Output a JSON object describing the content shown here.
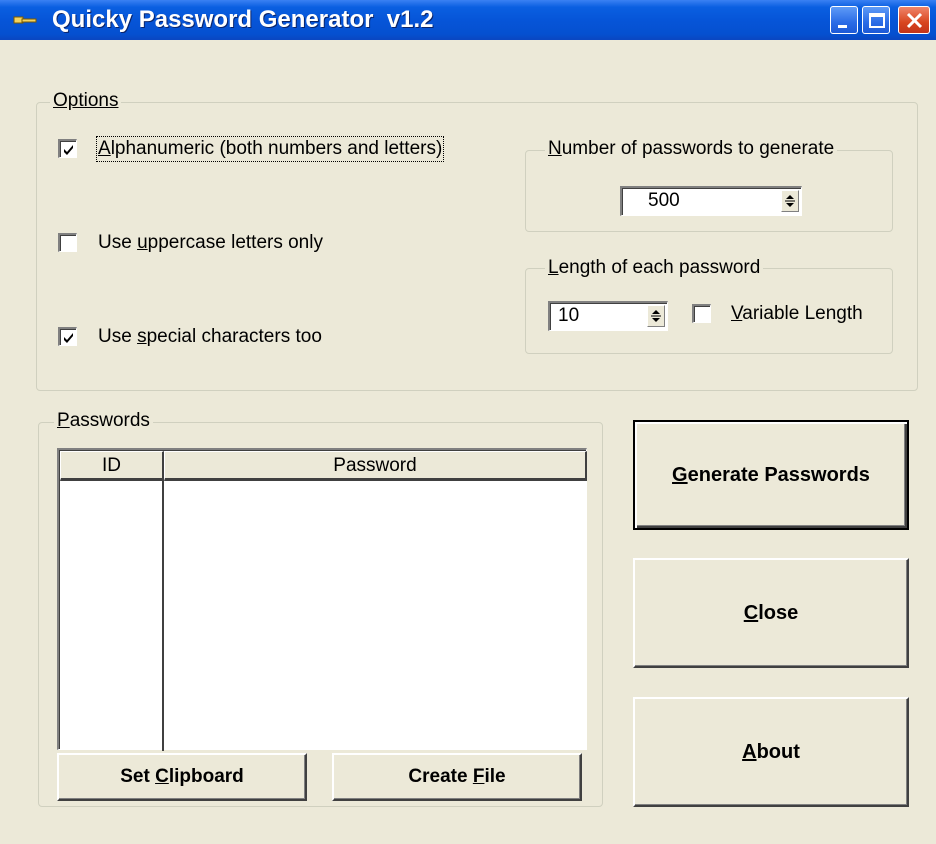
{
  "window": {
    "title": "Quicky Password Generator  v1.2"
  },
  "options": {
    "group_label": "Options",
    "alphanumeric": {
      "label": "Alphanumeric (both numbers and letters)",
      "mnemonic": "A",
      "checked": true
    },
    "uppercase_only": {
      "label_prefix": "Use ",
      "mnemonic": "u",
      "label_suffix": "ppercase letters only",
      "checked": false
    },
    "special_chars": {
      "label_prefix": "Use ",
      "mnemonic": "s",
      "label_suffix": "pecial characters too",
      "checked": true
    }
  },
  "count": {
    "group_label_mnemonic": "N",
    "group_label_rest": "umber of passwords to generate",
    "value": "500"
  },
  "length": {
    "group_label_prefix": "Length of each password",
    "value": "10",
    "variable_length": {
      "mnemonic": "V",
      "label_rest": "ariable Length",
      "checked": false
    }
  },
  "passwords": {
    "group_label_mnemonic": "P",
    "group_label_rest": "asswords",
    "columns": [
      "ID",
      "Password"
    ],
    "rows": []
  },
  "buttons": {
    "set_clipboard": {
      "prefix": "Set ",
      "mnemonic": "C",
      "rest": "lipboard"
    },
    "create_file": {
      "prefix": "Create ",
      "mnemonic": "F",
      "rest": "ile"
    },
    "generate": {
      "mnemonic": "G",
      "rest": "enerate Passwords"
    },
    "close": {
      "mnemonic": "C",
      "rest": "lose"
    },
    "about": {
      "mnemonic": "A",
      "rest": "bout"
    }
  },
  "icons": {
    "app": "key-icon",
    "minimize": "minimize-icon",
    "maximize": "maximize-icon",
    "close": "close-icon",
    "check": "checkmark-icon",
    "spin": "spin-arrows-icon"
  },
  "colors": {
    "titlebar": "#0655d8",
    "face": "#ece9d8",
    "close_button": "#d8451f"
  }
}
